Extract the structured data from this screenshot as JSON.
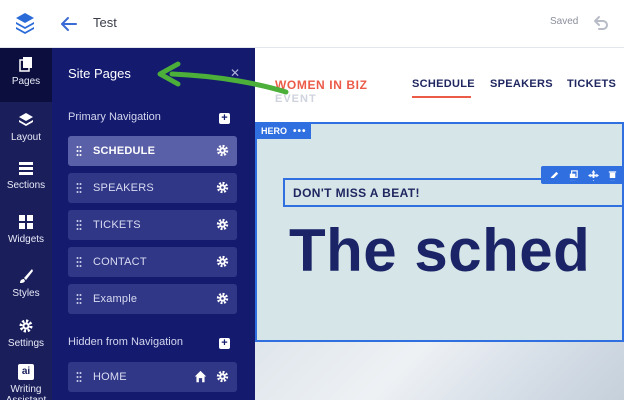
{
  "topbar": {
    "title": "Test",
    "saved": "Saved"
  },
  "rail": {
    "items": [
      {
        "label": "Pages",
        "icon": "pages-icon"
      },
      {
        "label": "Layout",
        "icon": "layers-icon"
      },
      {
        "label": "Sections",
        "icon": "sections-icon"
      },
      {
        "label": "Widgets",
        "icon": "widgets-icon"
      },
      {
        "label": "Styles",
        "icon": "brush-icon"
      },
      {
        "label": "Settings",
        "icon": "gear-icon"
      },
      {
        "label": "Writing Assistant",
        "icon": "ai-icon",
        "icon_text": "ai"
      }
    ]
  },
  "panel": {
    "title": "Site Pages",
    "primary_label": "Primary Navigation",
    "primary_pages": [
      "SCHEDULE",
      "SPEAKERS",
      "TICKETS",
      "CONTACT",
      "Example"
    ],
    "hidden_label": "Hidden from Navigation",
    "hidden_pages": [
      "HOME"
    ]
  },
  "site": {
    "brand_line1": "WOMEN IN BIZ",
    "brand_line2": "EVENT",
    "nav": [
      "SCHEDULE",
      "SPEAKERS",
      "TICKETS"
    ],
    "hero_tag": "HERO",
    "hero_dots": "•••",
    "eyebrow": "DON'T MISS A BEAT!",
    "headline": "The sched"
  },
  "colors": {
    "rail_bg": "#1a1f5c",
    "panel_bg": "#141a6e",
    "accent_blue": "#2f6fdf",
    "brand_red": "#ec5b48",
    "annotation_green": "#4caf3a"
  }
}
